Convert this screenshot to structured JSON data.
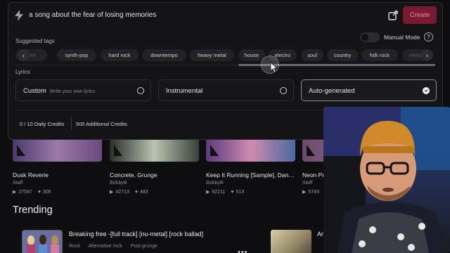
{
  "prompt": {
    "text": "a song about the fear of losing memories",
    "create_label": "Create"
  },
  "suggested_tags": {
    "label": "Suggested tags",
    "items": [
      "ient",
      "synth-pop",
      "hard rock",
      "downtempo",
      "heavy metal",
      "house",
      "electro",
      "soul",
      "country",
      "folk rock",
      "melod"
    ]
  },
  "manual_mode": {
    "label": "Manual Mode",
    "help": "?"
  },
  "lyrics": {
    "label": "Lyrics",
    "options": [
      {
        "label": "Custom",
        "sub": "Write your own lyrics"
      },
      {
        "label": "Instrumental",
        "sub": ""
      },
      {
        "label": "Auto-generated",
        "sub": ""
      }
    ]
  },
  "credits": {
    "daily": "0 / 10 Daily Credits",
    "additional": "500 Additional Credits"
  },
  "feed": {
    "cards": [
      {
        "title": "Dusk Reverie",
        "artist": "Staff",
        "plays": "27587",
        "likes": "305",
        "color": "#7a5a8e"
      },
      {
        "title": "Concrete, Grunge",
        "artist": "BobbyB",
        "plays": "42713",
        "likes": "483",
        "color": "#8a9a88"
      },
      {
        "title": "Keep It Running [Sample], Danc...",
        "artist": "BobbyB",
        "plays": "62211",
        "likes": "513",
        "color": "#9a6aa0"
      },
      {
        "title": "Neon Pu",
        "artist": "Staff",
        "plays": "5749",
        "likes": "",
        "color": "#a07a8e"
      }
    ],
    "trending_label": "Trending",
    "trending": [
      {
        "title": "Breaking free -[full track] [nu-metal] [rock ballad]",
        "tags": [
          "Rock",
          "Alternative rock",
          "Post-grunge"
        ],
        "menu": "•••"
      },
      {
        "title": "Ar",
        "tags": [
          "Ame"
        ]
      }
    ]
  }
}
